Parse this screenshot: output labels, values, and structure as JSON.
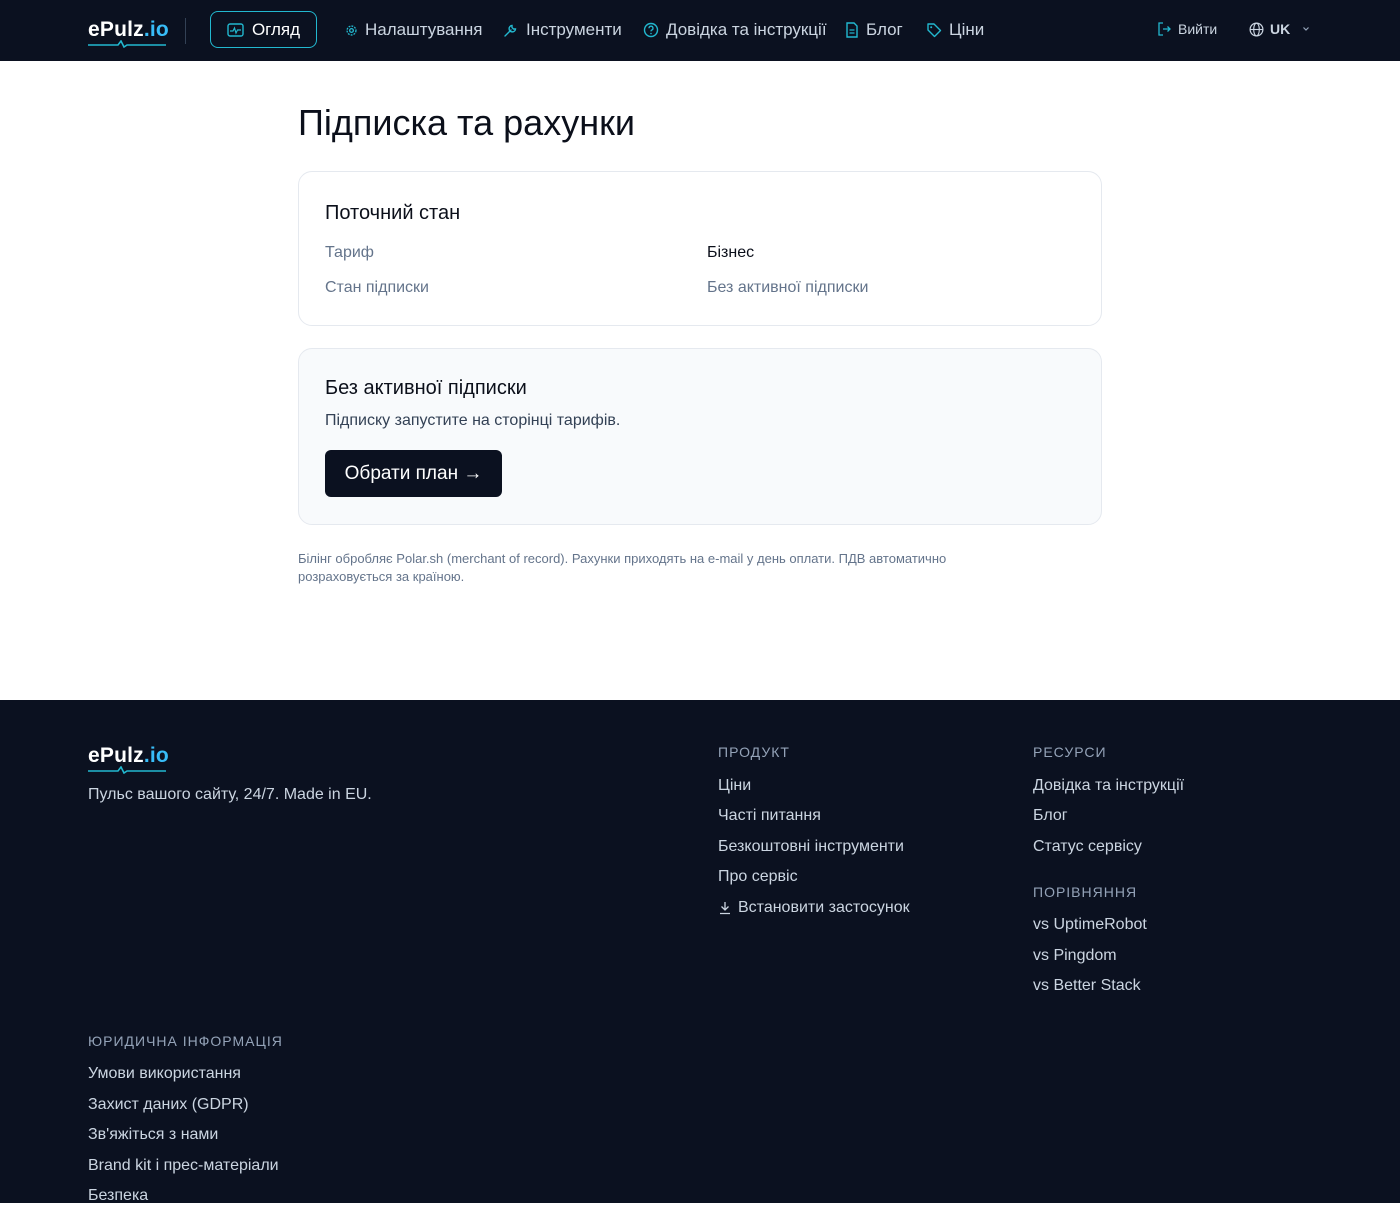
{
  "header": {
    "logo_main": "ePulz",
    "logo_suffix": ".io",
    "nav_active": {
      "label": "Огляд",
      "icon": "dashboard-icon"
    },
    "nav": [
      {
        "label": "Налаштування",
        "icon": "gear-icon"
      },
      {
        "label": "Інструменти",
        "icon": "wrench-icon"
      },
      {
        "label": "Довідка та інструкції",
        "icon": "help-circle-icon"
      },
      {
        "label": "Блог",
        "icon": "document-icon"
      },
      {
        "label": "Ціни",
        "icon": "tag-icon"
      }
    ],
    "logout_label": "Вийти",
    "language": "UK"
  },
  "main": {
    "title": "Підписка та рахунки",
    "status_card": {
      "heading": "Поточний стан",
      "rows": [
        {
          "label": "Тариф",
          "value": "Бізнес"
        },
        {
          "label": "Стан підписки",
          "value": "Без активної підписки"
        }
      ]
    },
    "cta_card": {
      "heading": "Без активної підписки",
      "text": "Підписку запустите на сторінці тарифів.",
      "button": "Обрати план →"
    },
    "billing_note": "Білінг обробляє Polar.sh (merchant of record). Рахунки приходять на e-mail у день оплати. ПДВ автоматично розраховується за країною."
  },
  "footer": {
    "tagline": "Пульс вашого сайту, 24/7. Made in EU.",
    "product": {
      "heading": "ПРОДУКТ",
      "links": [
        "Ціни",
        "Часті питання",
        "Безкоштовні інструменти",
        "Про сервіс",
        "Встановити застосунок"
      ]
    },
    "resources": {
      "heading": "РЕСУРСИ",
      "links": [
        "Довідка та інструкції",
        "Блог",
        "Статус сервісу"
      ]
    },
    "comparison": {
      "heading": "ПОРІВНЯННЯ",
      "links": [
        "vs UptimeRobot",
        "vs Pingdom",
        "vs Better Stack"
      ]
    },
    "legal": {
      "heading": "ЮРИДИЧНА ІНФОРМАЦІЯ",
      "links": [
        "Умови використання",
        "Захист даних (GDPR)",
        "Зв'яжіться з нами",
        "Brand kit і прес-матеріали",
        "Безпека"
      ]
    }
  },
  "colors": {
    "header_bg": "#0b1120",
    "accent": "#22b8cf",
    "logo_suffix": "#38bdf8",
    "button_bg": "#0b1120"
  }
}
